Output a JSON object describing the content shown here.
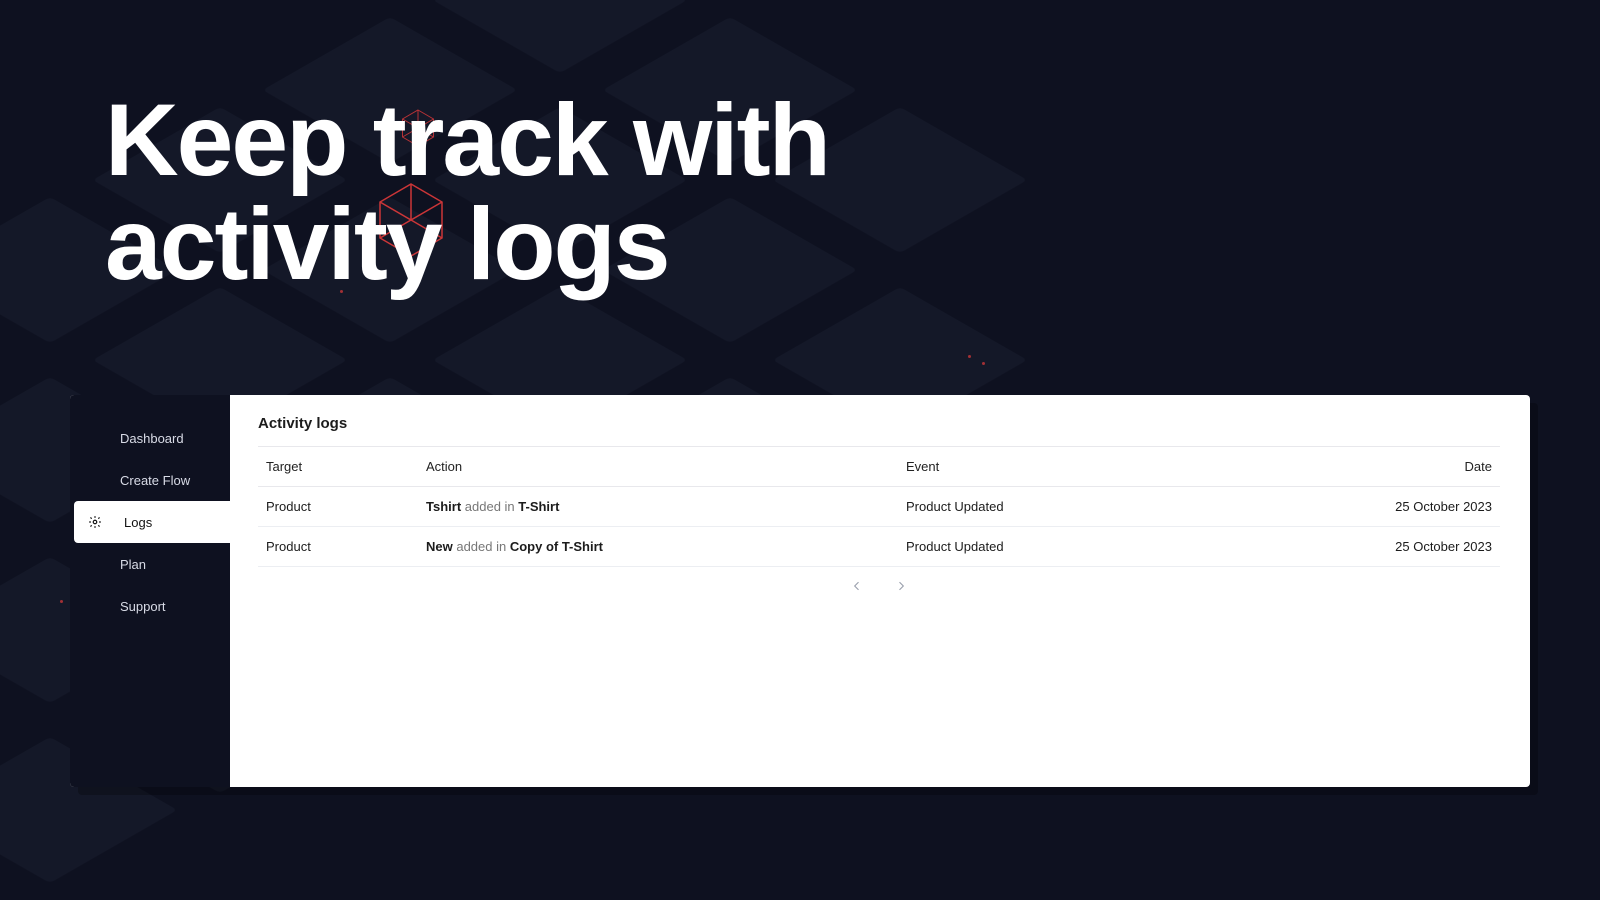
{
  "hero": {
    "line1": "Keep track with",
    "line2": "activity logs"
  },
  "sidebar": {
    "items": [
      {
        "label": "Dashboard"
      },
      {
        "label": "Create Flow"
      },
      {
        "label": "Logs"
      },
      {
        "label": "Plan"
      },
      {
        "label": "Support"
      }
    ],
    "activeIndex": 2
  },
  "content": {
    "title": "Activity logs",
    "columns": {
      "target": "Target",
      "action": "Action",
      "event": "Event",
      "date": "Date"
    },
    "rows": [
      {
        "target": "Product",
        "action_strong1": "Tshirt",
        "action_mid": " added in ",
        "action_strong2": "T-Shirt",
        "event": "Product Updated",
        "date": "25 October 2023"
      },
      {
        "target": "Product",
        "action_strong1": "New",
        "action_mid": " added in ",
        "action_strong2": "Copy of T-Shirt",
        "event": "Product Updated",
        "date": "25 October 2023"
      }
    ]
  }
}
